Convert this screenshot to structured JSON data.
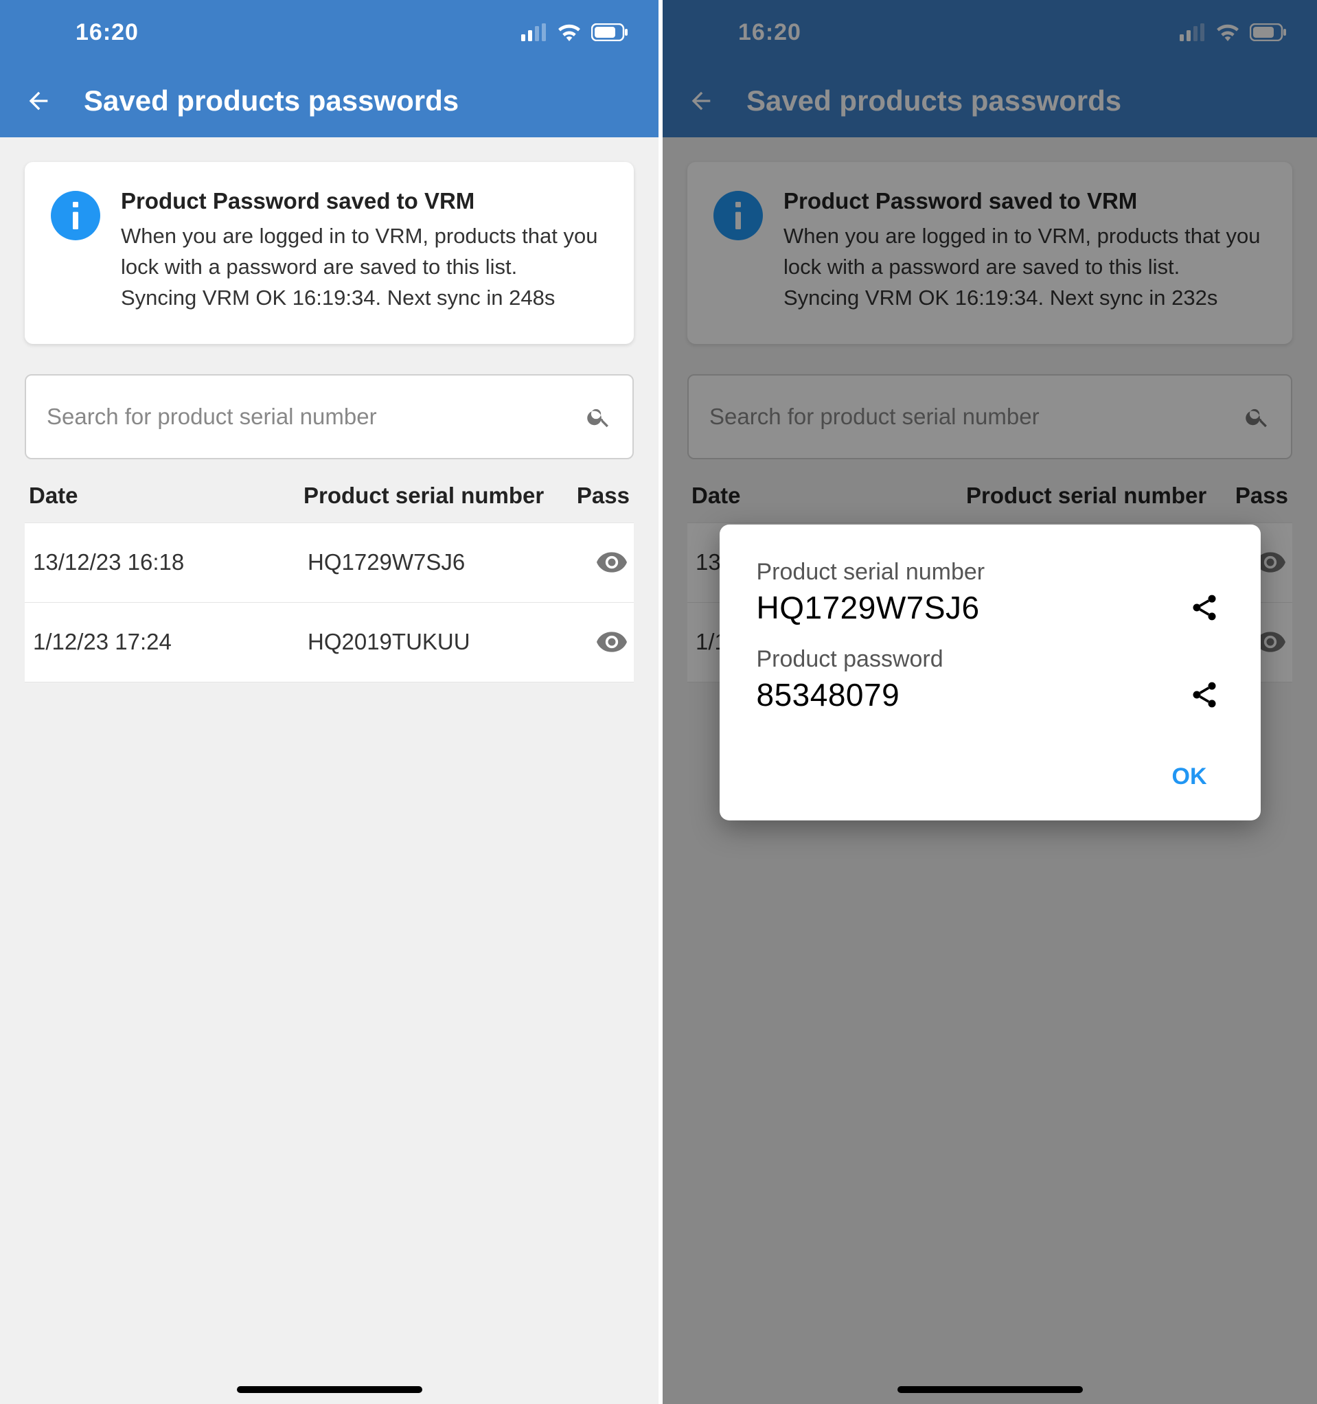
{
  "status": {
    "time": "16:20"
  },
  "header": {
    "title": "Saved products passwords"
  },
  "info": {
    "title": "Product Password saved to VRM",
    "body_left": "When you are logged in to VRM, products that you lock with a password are saved to this list.\nSyncing VRM OK 16:19:34. Next sync in 248s",
    "body_right": "When you are logged in to VRM, products that you lock with a password are saved to this list.\nSyncing VRM OK 16:19:34. Next sync in 232s"
  },
  "search": {
    "placeholder": "Search for product serial number"
  },
  "table": {
    "headers": {
      "date": "Date",
      "serial": "Product serial number",
      "pass": "Pass"
    },
    "rows": [
      {
        "date": "13/12/23 16:18",
        "serial": "HQ1729W7SJ6"
      },
      {
        "date": "1/12/23 17:24",
        "serial": "HQ2019TUKUU"
      }
    ]
  },
  "dialog": {
    "serial_label": "Product serial number",
    "serial_value": "HQ1729W7SJ6",
    "password_label": "Product password",
    "password_value": "85348079",
    "ok": "OK"
  }
}
